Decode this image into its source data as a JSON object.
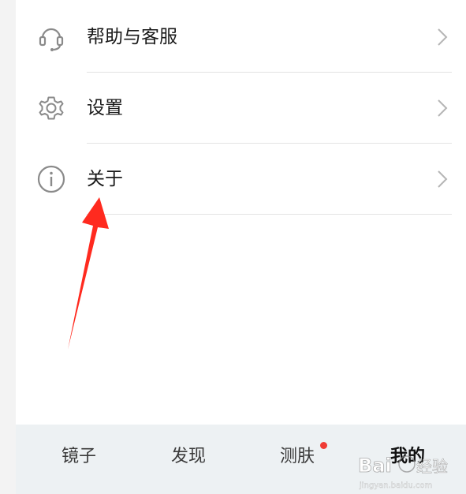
{
  "menu": {
    "items": [
      {
        "label": "帮助与客服",
        "icon": "headset-icon"
      },
      {
        "label": "设置",
        "icon": "gear-icon"
      },
      {
        "label": "关于",
        "icon": "info-icon"
      }
    ]
  },
  "tabbar": {
    "tabs": [
      {
        "label": "镜子"
      },
      {
        "label": "发现"
      },
      {
        "label": "测肤",
        "badge": true
      },
      {
        "label": "我的",
        "active": true
      }
    ]
  },
  "colors": {
    "arrow": "#ff2a1f",
    "badge": "#f03c35",
    "icon": "#8a8a8a"
  }
}
